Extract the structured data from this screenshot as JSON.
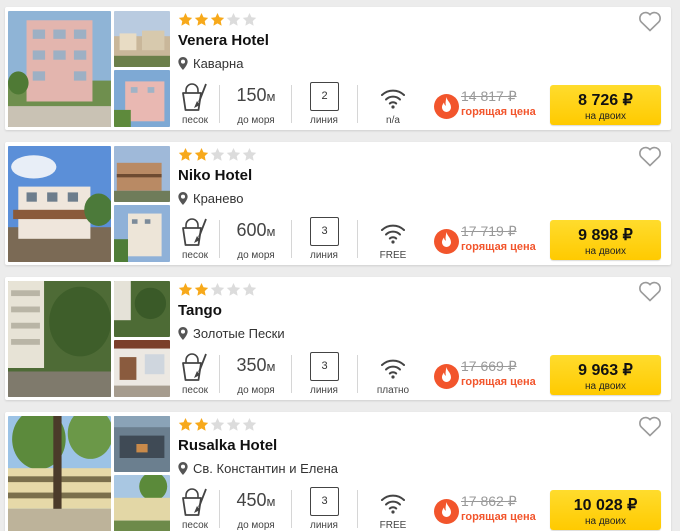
{
  "colors": {
    "star_on": "#f7a91b",
    "star_off": "#dcdcdc",
    "hot": "#f2552c",
    "button": "#ffd21a"
  },
  "hotels": [
    {
      "stars": 3,
      "name": "Venera Hotel",
      "location": "Каварна",
      "beach_label": "песок",
      "distance_value": "150",
      "distance_unit": "м",
      "distance_label": "до моря",
      "line_number": "2",
      "line_label": "линия",
      "wifi_label": "n/a",
      "old_price": "14 817 ₽",
      "hot_label": "горящая цена",
      "price": "8 726 ₽",
      "price_note": "на двоих"
    },
    {
      "stars": 2,
      "name": "Niko Hotel",
      "location": "Кранево",
      "beach_label": "песок",
      "distance_value": "600",
      "distance_unit": "м",
      "distance_label": "до моря",
      "line_number": "3",
      "line_label": "линия",
      "wifi_label": "FREE",
      "old_price": "17 719 ₽",
      "hot_label": "горящая цена",
      "price": "9 898 ₽",
      "price_note": "на двоих"
    },
    {
      "stars": 2,
      "name": "Tango",
      "location": "Золотые Пески",
      "beach_label": "песок",
      "distance_value": "350",
      "distance_unit": "м",
      "distance_label": "до моря",
      "line_number": "3",
      "line_label": "линия",
      "wifi_label": "платно",
      "old_price": "17 669 ₽",
      "hot_label": "горящая цена",
      "price": "9 963 ₽",
      "price_note": "на двоих"
    },
    {
      "stars": 2,
      "name": "Rusalka Hotel",
      "location": "Св. Константин и Елена",
      "beach_label": "песок",
      "distance_value": "450",
      "distance_unit": "м",
      "distance_label": "до моря",
      "line_number": "3",
      "line_label": "линия",
      "wifi_label": "FREE",
      "old_price": "17 862 ₽",
      "hot_label": "горящая цена",
      "price": "10 028 ₽",
      "price_note": "на двоих"
    }
  ]
}
